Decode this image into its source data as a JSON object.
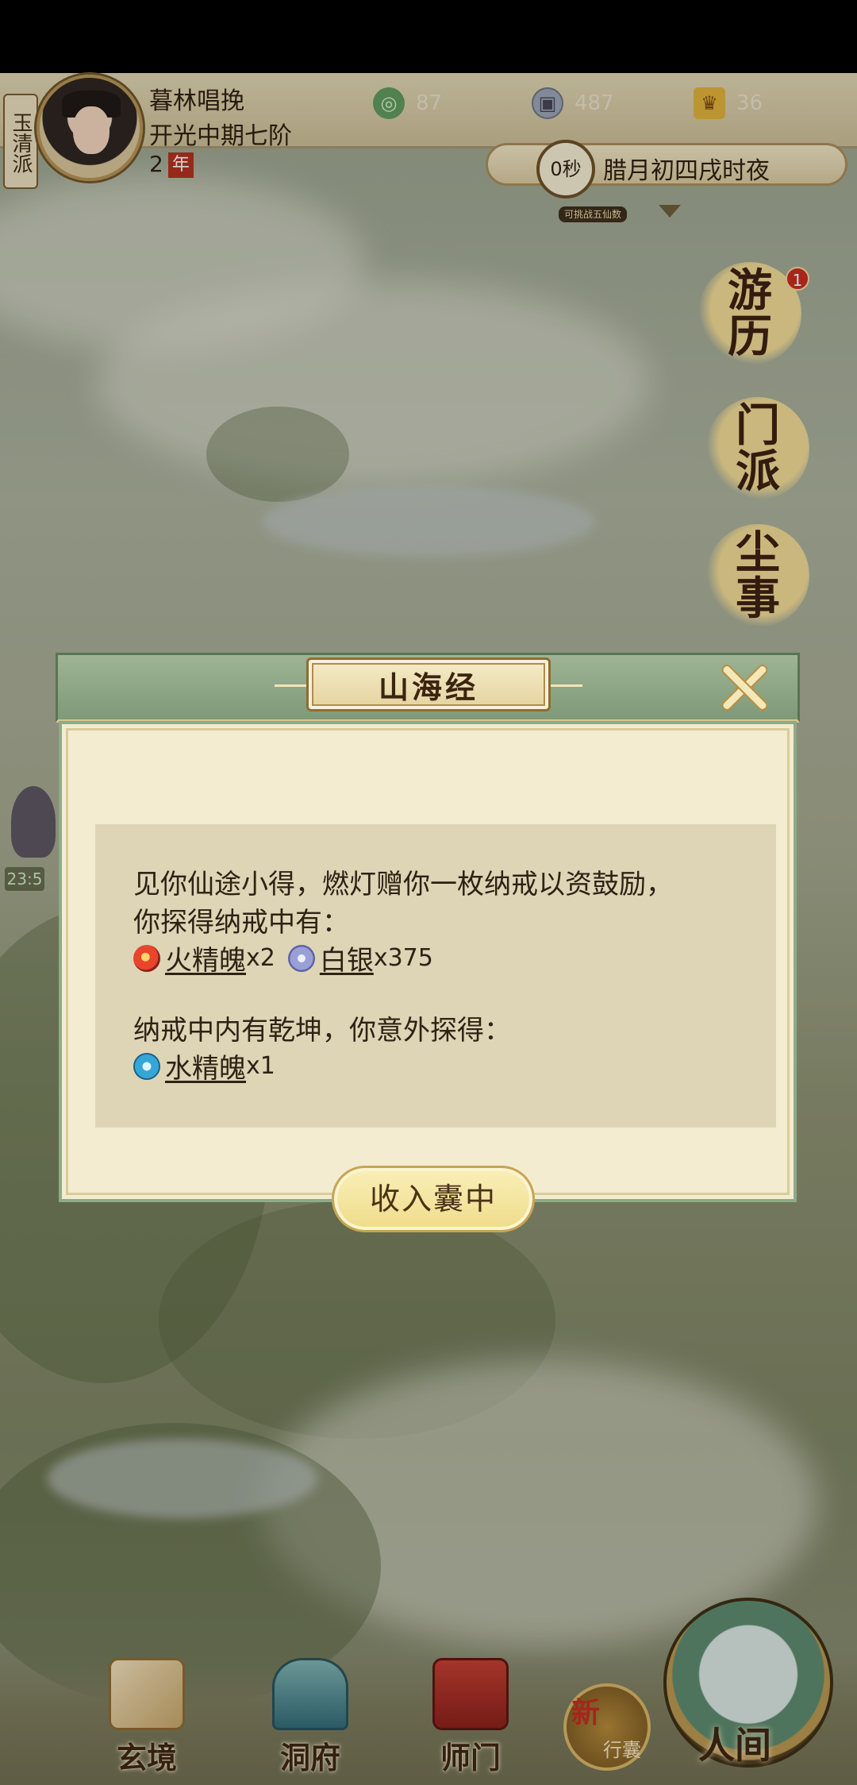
{
  "hud": {
    "sect": "玉清派",
    "player_name": "暮林唱挽",
    "cultivation_rank": "开光中期七阶",
    "years_value": "2",
    "years_unit": "年",
    "resources": [
      {
        "name": "jade",
        "icon": "jade-swirl-icon",
        "value": "87"
      },
      {
        "name": "coin",
        "icon": "copper-coin-icon",
        "value": "487"
      },
      {
        "name": "gold",
        "icon": "gold-ingot-icon",
        "value": "36"
      }
    ],
    "timer": "0秒",
    "game_date": "腊月初四戌时夜",
    "timer_caption": "可挑战五仙数"
  },
  "side_menu": {
    "travel": [
      "游",
      "历"
    ],
    "travel_badge": "1",
    "sect": [
      "门",
      "派"
    ],
    "world": [
      "尘",
      "事"
    ]
  },
  "left_timer": "23:5",
  "dialog": {
    "title": "山海经",
    "line1": "见你仙途小得，燃灯赠你一枚纳戒以资鼓励，",
    "line2": "你探得纳戒中有：",
    "items": [
      {
        "icon": "fire-essence-icon",
        "name": "火精魄",
        "qty": "x2"
      },
      {
        "icon": "silver-coin-icon",
        "name": "白银",
        "qty": "x375"
      }
    ],
    "line4": "纳戒中内有乾坤，你意外探得：",
    "bonus_items": [
      {
        "icon": "water-essence-icon",
        "name": "水精魄",
        "qty": "x1"
      }
    ],
    "button": "收入囊中"
  },
  "bottom_nav": {
    "xuanjing": "玄境",
    "dongfu": "洞府",
    "shimen": "师门",
    "bag_new": "新",
    "bag": "行囊",
    "world": "人间"
  }
}
